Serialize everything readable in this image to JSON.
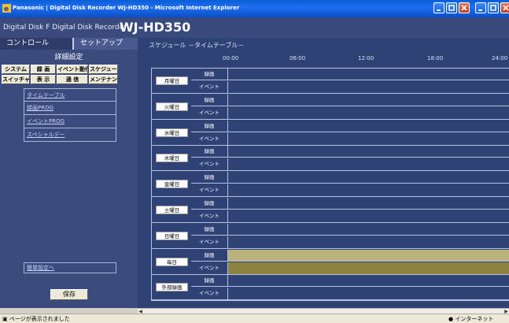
{
  "window": {
    "title_brand": "Panasonic",
    "title": "Panasonic | Digital Disk Recorder WJ-HD350 - Microsoft Internet Explorer"
  },
  "header": {
    "brand": "Digital Disk F  Digital Disk Recorder",
    "model": "WJ-HD350"
  },
  "tabs": {
    "control": "コントロール",
    "setup": "セットアップ"
  },
  "left": {
    "title": "詳細設定",
    "buttons_row1": [
      "システム",
      "録 画",
      "イベント動作",
      "スケジュール"
    ],
    "buttons_row2": [
      "スイッチャー",
      "表 示",
      "通 信",
      "メンテナンス"
    ],
    "submenu": [
      "タイムテーブル",
      "録画PROG",
      "イベントPROG",
      "スペシャルデー"
    ],
    "easy_link": "簡単設定へ",
    "save": "保存"
  },
  "main": {
    "title": "スケジュール －タイムテーブル－",
    "time_labels": [
      "00:00",
      "06:00",
      "12:00",
      "18:00",
      "24:00"
    ],
    "row_labels": {
      "rec": "録画",
      "event": "イベント"
    },
    "days": [
      {
        "name": "月曜日",
        "rec_level": 0,
        "event_level": 0
      },
      {
        "name": "火曜日",
        "rec_level": 0,
        "event_level": 0
      },
      {
        "name": "水曜日",
        "rec_level": 0,
        "event_level": 0
      },
      {
        "name": "木曜日",
        "rec_level": 0,
        "event_level": 0
      },
      {
        "name": "金曜日",
        "rec_level": 0,
        "event_level": 0
      },
      {
        "name": "土曜日",
        "rec_level": 0,
        "event_level": 0
      },
      {
        "name": "日曜日",
        "rec_level": 0,
        "event_level": 0
      },
      {
        "name": "毎日",
        "rec_level": 1,
        "event_level": 1
      },
      {
        "name": "外部録画",
        "rec_level": 0,
        "event_level": 0
      }
    ]
  },
  "status": {
    "left": "ページが表示されました",
    "right": "インターネット"
  },
  "colors": {
    "panel_bg": "#2f4276",
    "rec_fill": "#b9b27a",
    "event_fill": "#8d8340"
  }
}
